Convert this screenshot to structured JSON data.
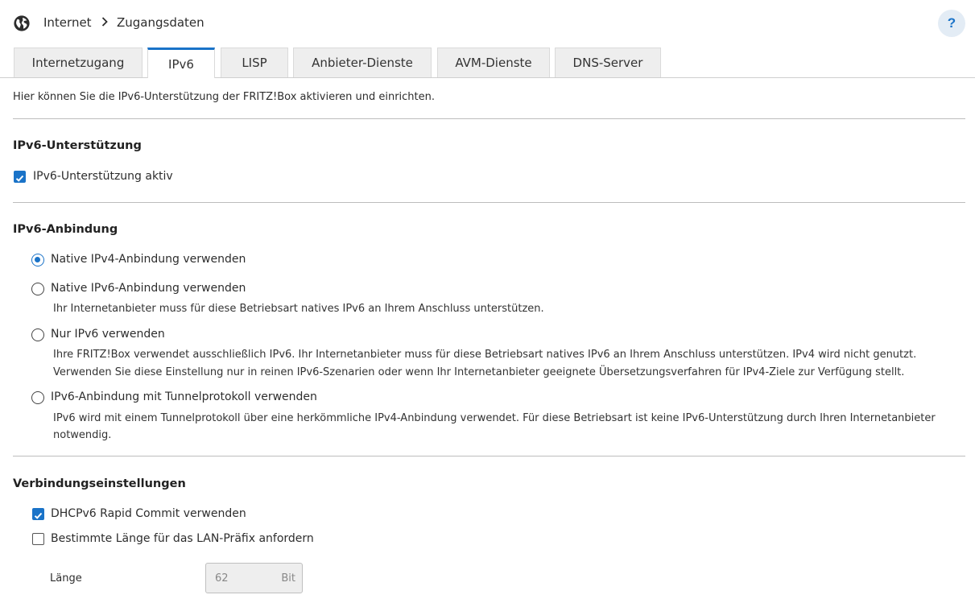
{
  "breadcrumb": {
    "root": "Internet",
    "current": "Zugangsdaten"
  },
  "help_label": "?",
  "tabs": [
    "Internetzugang",
    "IPv6",
    "LISP",
    "Anbieter-Dienste",
    "AVM-Dienste",
    "DNS-Server"
  ],
  "active_tab": "IPv6",
  "intro": "Hier können Sie die IPv6-Unterstützung der FRITZ!Box aktivieren und einrichten.",
  "support": {
    "heading": "IPv6-Unterstützung",
    "checkbox_label": "IPv6-Unterstützung aktiv",
    "checked": true
  },
  "binding": {
    "heading": "IPv6-Anbindung",
    "options": [
      {
        "label": "Native IPv4-Anbindung verwenden",
        "selected": true,
        "desc": []
      },
      {
        "label": "Native IPv6-Anbindung verwenden",
        "selected": false,
        "desc": [
          "Ihr Internetanbieter muss für diese Betriebsart natives IPv6 an Ihrem Anschluss unterstützen."
        ]
      },
      {
        "label": "Nur IPv6 verwenden",
        "selected": false,
        "desc": [
          "Ihre FRITZ!Box verwendet ausschließlich IPv6. Ihr Internetanbieter muss für diese Betriebsart natives IPv6 an Ihrem Anschluss unterstützen. IPv4 wird nicht genutzt.",
          "Verwenden Sie diese Einstellung nur in reinen IPv6-Szenarien oder wenn Ihr Internetanbieter geeignete Übersetzungsverfahren für IPv4-Ziele zur Verfügung stellt."
        ]
      },
      {
        "label": "IPv6-Anbindung mit Tunnelprotokoll verwenden",
        "selected": false,
        "desc": [
          "IPv6 wird mit einem Tunnelprotokoll über eine herkömmliche IPv4-Anbindung verwendet. Für diese Betriebsart ist keine IPv6-Unterstützung durch Ihren Internetanbieter",
          "notwendig."
        ]
      }
    ]
  },
  "connection": {
    "heading": "Verbindungseinstellungen",
    "rapid_commit": {
      "label": "DHCPv6 Rapid Commit verwenden",
      "checked": true
    },
    "prefix_length": {
      "label": "Bestimmte Länge für das LAN-Präfix anfordern",
      "checked": false
    },
    "length_label": "Länge",
    "length_value": "62",
    "length_unit": "Bit"
  },
  "colors": {
    "accent": "#1a73c8",
    "tab_bg": "#eeeeee",
    "divider": "#bdbdbd"
  },
  "icons": {
    "globe": "globe-icon",
    "separator": "chevron-right-icon",
    "check": "check-icon"
  }
}
